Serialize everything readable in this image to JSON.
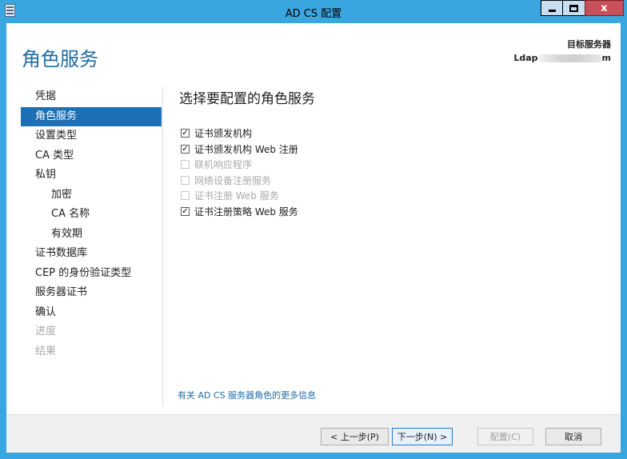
{
  "window": {
    "title": "AD CS 配置",
    "close_glyph": "x"
  },
  "header": {
    "title": "角色服务",
    "target_label": "目标服务器",
    "target_prefix": "Ldap",
    "target_suffix": "m"
  },
  "nav": {
    "items": [
      {
        "label": "凭据",
        "state": "normal"
      },
      {
        "label": "角色服务",
        "state": "active"
      },
      {
        "label": "设置类型",
        "state": "normal"
      },
      {
        "label": "CA 类型",
        "state": "normal"
      },
      {
        "label": "私钥",
        "state": "normal"
      },
      {
        "label": "加密",
        "state": "sub"
      },
      {
        "label": "CA 名称",
        "state": "sub"
      },
      {
        "label": "有效期",
        "state": "sub"
      },
      {
        "label": "证书数据库",
        "state": "normal"
      },
      {
        "label": "CEP 的身份验证类型",
        "state": "normal"
      },
      {
        "label": "服务器证书",
        "state": "normal"
      },
      {
        "label": "确认",
        "state": "normal"
      },
      {
        "label": "进度",
        "state": "disabled"
      },
      {
        "label": "结果",
        "state": "disabled"
      }
    ]
  },
  "main": {
    "heading": "选择要配置的角色服务",
    "options": [
      {
        "label": "证书颁发机构",
        "checked": true,
        "enabled": true
      },
      {
        "label": "证书颁发机构 Web 注册",
        "checked": true,
        "enabled": true
      },
      {
        "label": "联机响应程序",
        "checked": false,
        "enabled": false
      },
      {
        "label": "网络设备注册服务",
        "checked": false,
        "enabled": false
      },
      {
        "label": "证书注册 Web 服务",
        "checked": false,
        "enabled": false
      },
      {
        "label": "证书注册策略 Web 服务",
        "checked": true,
        "enabled": true
      }
    ],
    "more_info_link": "有关 AD CS 服务器角色的更多信息"
  },
  "footer": {
    "prev": "< 上一步(P)",
    "next": "下一步(N) >",
    "configure": "配置(C)",
    "cancel": "取消"
  },
  "colors": {
    "frame": "#3aa6e0",
    "accent": "#1f6ba5",
    "nav_active": "#1e6fb4",
    "close_button": "#c7505a"
  }
}
